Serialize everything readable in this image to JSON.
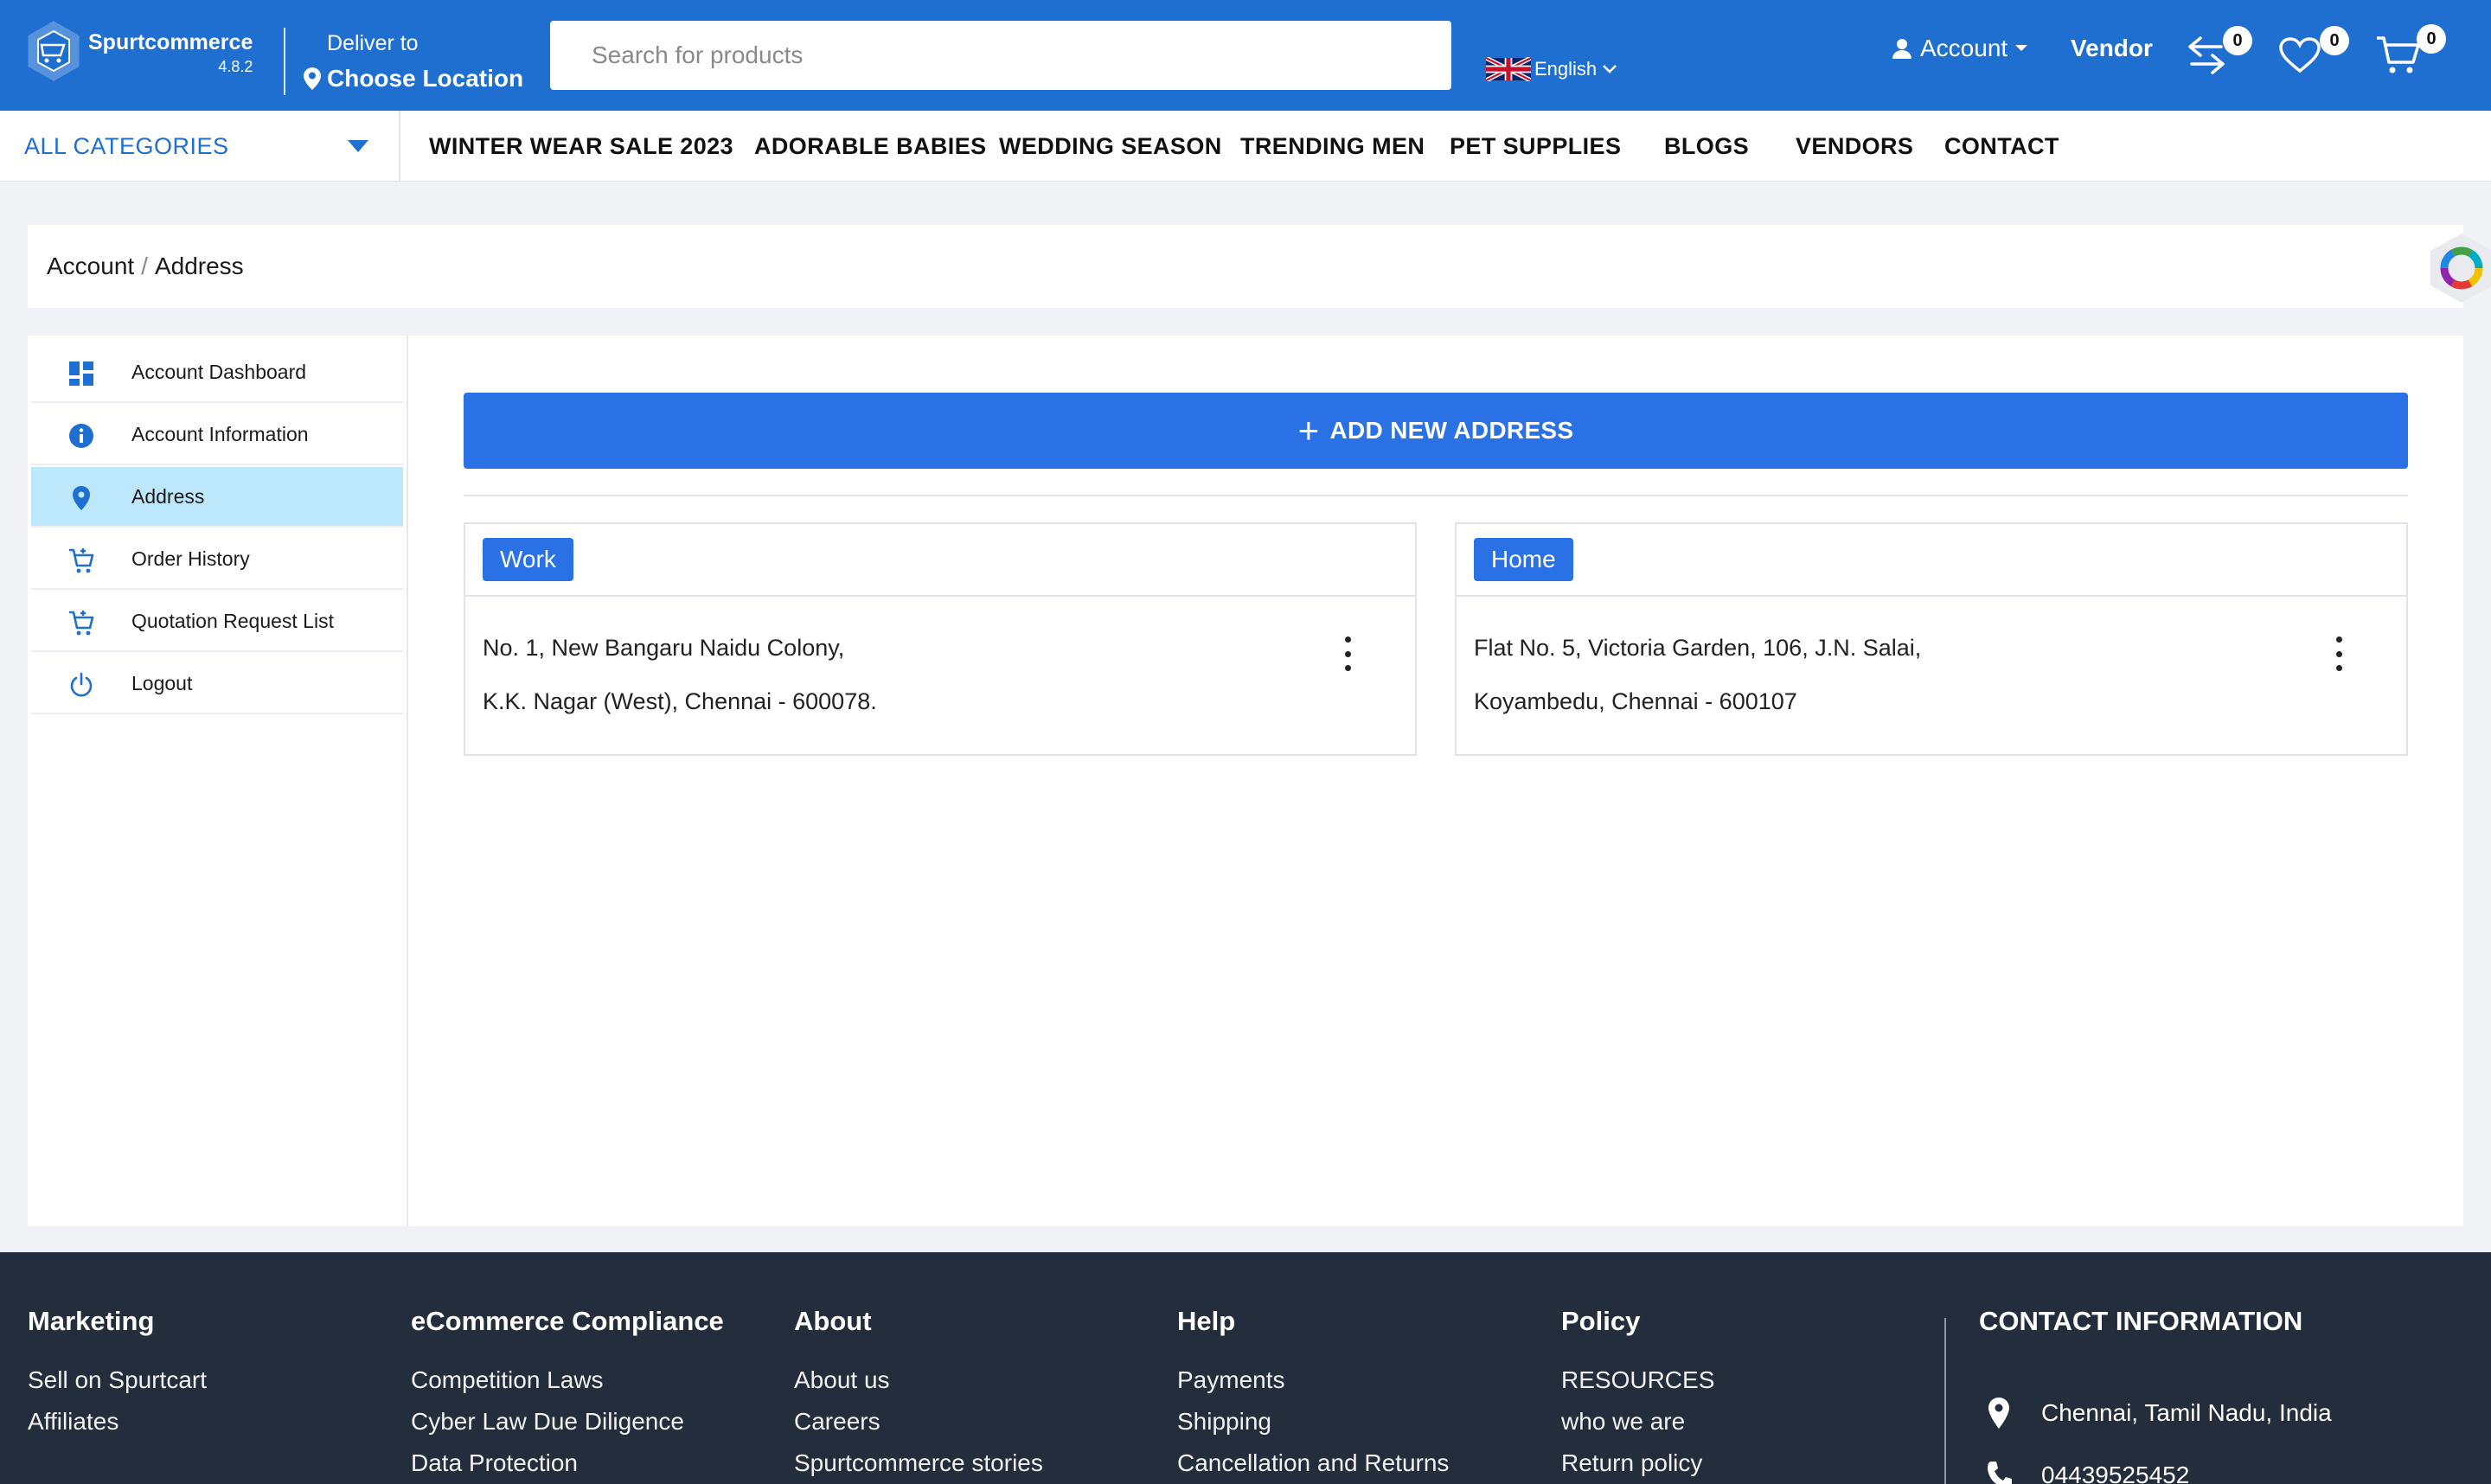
{
  "header": {
    "logo": {
      "name": "Spurtcommerce",
      "version": "4.8.2"
    },
    "deliver": {
      "label": "Deliver to",
      "location": "Choose Location"
    },
    "search": {
      "placeholder": "Search for products"
    },
    "language": "English",
    "account_label": "Account",
    "vendor_label": "Vendor",
    "compare_count": "0",
    "wishlist_count": "0",
    "cart_count": "0"
  },
  "nav": {
    "all_categories": "ALL CATEGORIES",
    "items": [
      "WINTER WEAR SALE 2023",
      "ADORABLE BABIES",
      "WEDDING SEASON",
      "TRENDING MEN",
      "PET SUPPLIES",
      "BLOGS",
      "VENDORS",
      "CONTACT"
    ]
  },
  "breadcrumb": {
    "parent": "Account",
    "separator": "/",
    "current": "Address"
  },
  "sidebar": {
    "items": [
      {
        "label": "Account Dashboard",
        "icon": "dashboard-icon"
      },
      {
        "label": "Account Information",
        "icon": "info-icon"
      },
      {
        "label": "Address",
        "icon": "location-pin-icon",
        "active": true
      },
      {
        "label": "Order History",
        "icon": "cart-icon"
      },
      {
        "label": "Quotation Request List",
        "icon": "cart-icon"
      },
      {
        "label": "Logout",
        "icon": "power-icon"
      }
    ]
  },
  "main": {
    "add_button": "ADD NEW ADDRESS",
    "addresses": [
      {
        "type": "Work",
        "line1": "No. 1, New Bangaru Naidu Colony,",
        "line2": "K.K. Nagar (West), Chennai - 600078."
      },
      {
        "type": "Home",
        "line1": "Flat No. 5, Victoria Garden, 106, J.N. Salai,",
        "line2": "Koyambedu, Chennai - 600107"
      }
    ]
  },
  "footer": {
    "columns": [
      {
        "title": "Marketing",
        "links": [
          "Sell on Spurtcart",
          "Affiliates"
        ]
      },
      {
        "title": "eCommerce Compliance",
        "links": [
          "Competition Laws",
          "Cyber Law Due Diligence",
          "Data Protection"
        ]
      },
      {
        "title": "About",
        "links": [
          "About us",
          "Careers",
          "Spurtcommerce stories"
        ]
      },
      {
        "title": "Help",
        "links": [
          "Payments",
          "Shipping",
          "Cancellation and Returns"
        ]
      },
      {
        "title": "Policy",
        "links": [
          "RESOURCES",
          "who we are",
          "Return policy"
        ]
      }
    ],
    "contact": {
      "title": "CONTACT INFORMATION",
      "address": "Chennai, Tamil Nadu, India",
      "phone": "04439525452"
    }
  },
  "colors": {
    "primary": "#1f6fd1",
    "button": "#2a71e6",
    "active_sidebar": "#bde8fb",
    "footer_bg": "#232d3b"
  }
}
